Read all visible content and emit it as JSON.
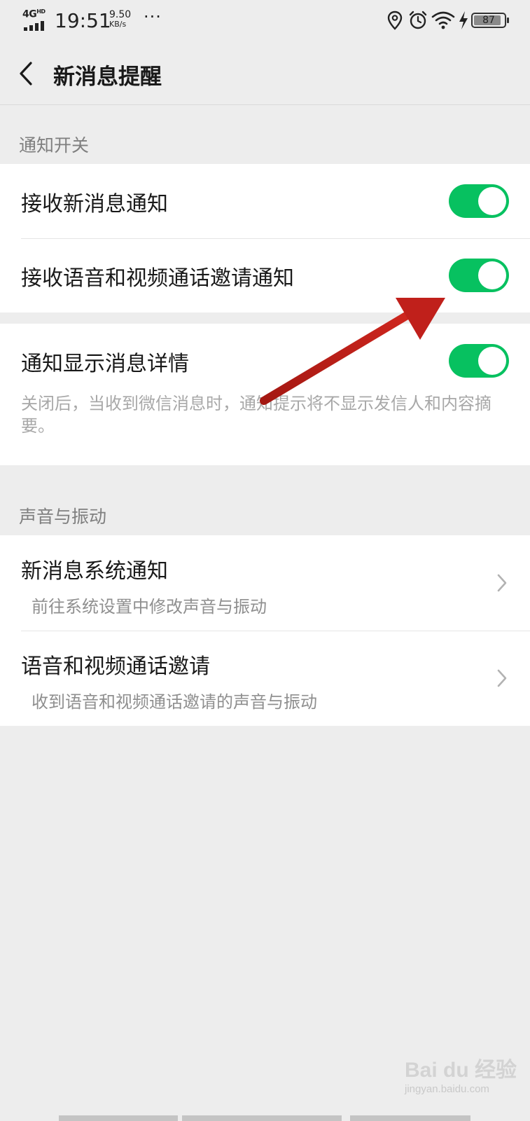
{
  "status_bar": {
    "network": "4G",
    "network_sup": "HD",
    "time": "19:51",
    "speed_value": "9.50",
    "speed_unit": "KB/s",
    "more": "···",
    "battery": "87",
    "icons": [
      "location-icon",
      "alarm-icon",
      "wifi-icon",
      "charging-icon",
      "battery-icon"
    ]
  },
  "header": {
    "back_icon": "chevron-left-icon",
    "title": "新消息提醒"
  },
  "section_notifications": {
    "label": "通知开关",
    "rows": [
      {
        "title": "接收新消息通知",
        "toggle_on": true
      },
      {
        "title": "接收语音和视频通话邀请通知",
        "toggle_on": true
      }
    ]
  },
  "detail_card": {
    "title": "通知显示消息详情",
    "toggle_on": true,
    "description": "关闭后，当收到微信消息时，通知提示将不显示发信人和内容摘要。"
  },
  "section_sound": {
    "label": "声音与振动",
    "rows": [
      {
        "title": "新消息系统通知",
        "subtitle": "前往系统设置中修改声音与振动"
      },
      {
        "title": "语音和视频通话邀请",
        "subtitle": "收到语音和视频通话邀请的声音与振动"
      }
    ]
  },
  "annotation": {
    "color": "#c0201b",
    "icon": "red-arrow-pointer"
  },
  "watermark": {
    "logo": "Bai du 经验",
    "url": "jingyan.baidu.com"
  },
  "colors": {
    "toggle_on": "#07c160",
    "background": "#ededed",
    "card": "#ffffff",
    "primary_text": "#191919",
    "secondary_text": "#8f8f8f"
  }
}
